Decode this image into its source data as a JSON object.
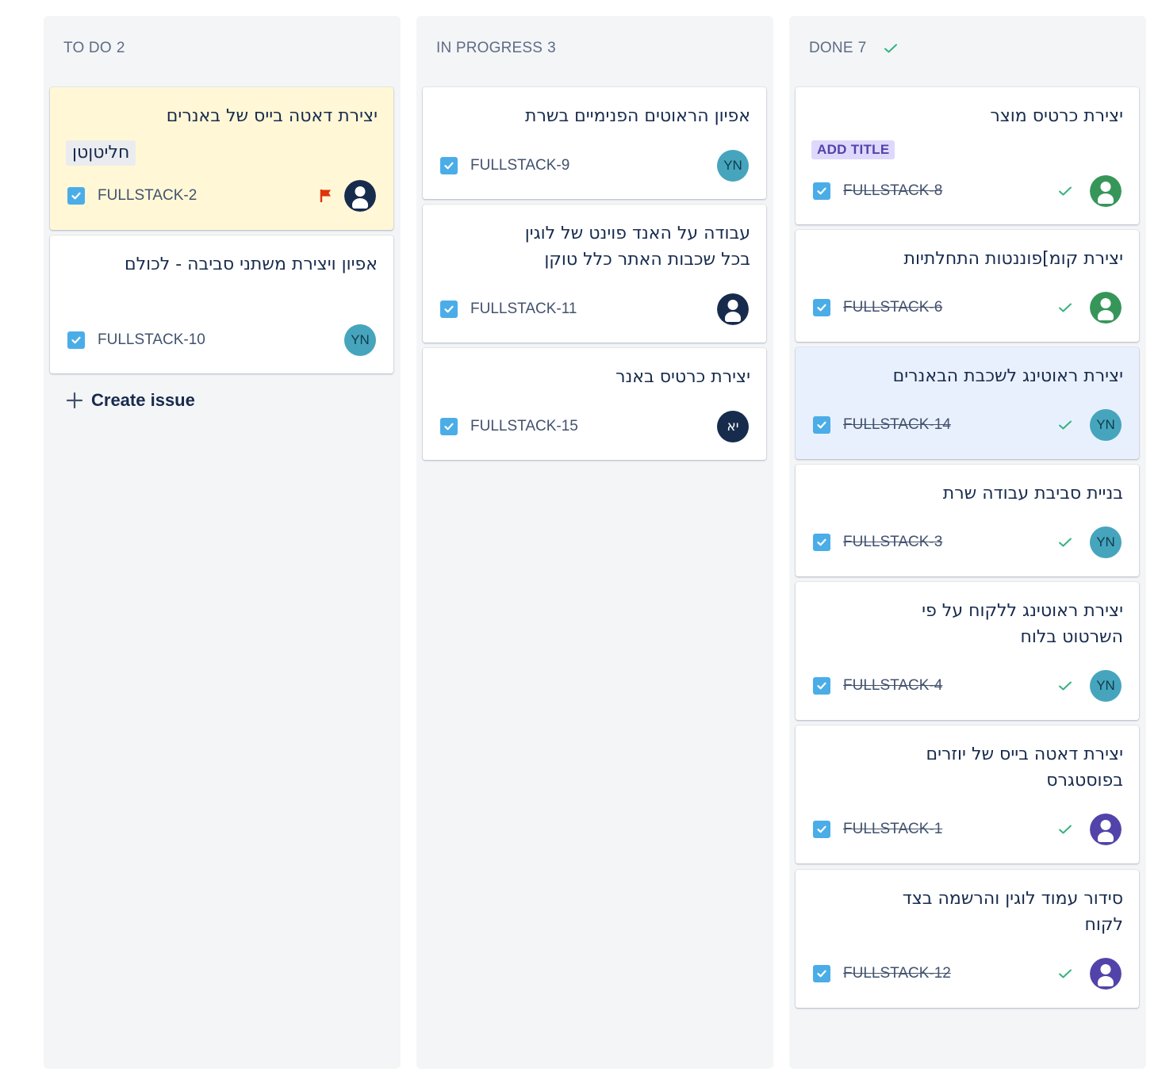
{
  "colors": {
    "column_bg": "#f4f5f7",
    "flagged_card": "#fff7d6",
    "selected_card": "#e9f0fd",
    "task_icon": "#4bade8",
    "done_check": "#36b37e",
    "flag": "#de350b",
    "avatar_yn": "#46a5bd",
    "label_bg": "#dfd8fd"
  },
  "columns": {
    "todo": {
      "name": "TO DO",
      "count": "2",
      "create_issue_label": "Create issue",
      "cards": [
        {
          "title": "יצירת דאטה בייס של באנרים",
          "tag": "חליטןטן",
          "key": "FULLSTACK-2",
          "flagged": true,
          "assignee": "default-avatar"
        },
        {
          "title": "אפיון ויצירת משתני סביבה - לכולם",
          "key": "FULLSTACK-10",
          "assignee": "YN"
        }
      ]
    },
    "inprogress": {
      "name": "IN PROGRESS",
      "count": "3",
      "cards": [
        {
          "title": "אפיון הראוטים הפנימיים בשרת",
          "key": "FULLSTACK-9",
          "assignee": "YN"
        },
        {
          "title": "עבודה על האנד פוינט של לוגין בכל שכבות האתר כלל טוקן",
          "key": "FULLSTACK-11",
          "assignee": "default-avatar"
        },
        {
          "title": "יצירת כרטיס באנר",
          "key": "FULLSTACK-15",
          "assignee": "יא"
        }
      ]
    },
    "done": {
      "name": "DONE",
      "count": "7",
      "cards": [
        {
          "title": "יצירת כרטיס מוצר",
          "label": "ADD TITLE",
          "key": "FULLSTACK-8",
          "assignee": "green-avatar"
        },
        {
          "title": "יצירת קומ]פוננטות התחלתיות",
          "key": "FULLSTACK-6",
          "assignee": "green-avatar"
        },
        {
          "title": "יצירת ראוטינג לשכבת הבאנרים",
          "key": "FULLSTACK-14",
          "assignee": "YN",
          "selected": true
        },
        {
          "title": "בניית סביבת עבודה שרת",
          "key": "FULLSTACK-3",
          "assignee": "YN"
        },
        {
          "title": "יצירת ראוטינג ללקוח על פי השרטוט בלוח",
          "key": "FULLSTACK-4",
          "assignee": "YN"
        },
        {
          "title": "יצירת דאטה בייס של יוזרים בפוסטגרס",
          "key": "FULLSTACK-1",
          "assignee": "purple-avatar"
        },
        {
          "title": "סידור עמוד לוגין והרשמה בצד לקוח",
          "key": "FULLSTACK-12",
          "assignee": "purple-avatar"
        }
      ]
    }
  }
}
